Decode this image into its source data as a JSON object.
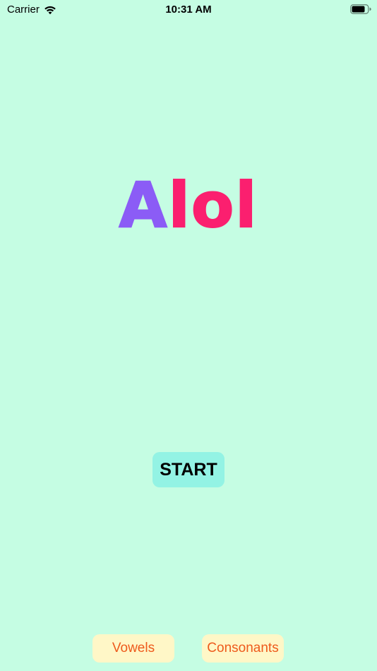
{
  "status_bar": {
    "carrier": "Carrier",
    "time": "10:31 AM",
    "wifi_icon": "wifi-icon",
    "battery_icon": "battery-icon"
  },
  "logo": {
    "first_letter": "A",
    "rest": "lol",
    "first_letter_color": "#8b5cf6",
    "rest_color": "#fb1f6f"
  },
  "start_button": {
    "label": "START"
  },
  "bottom_buttons": {
    "vowels_label": "Vowels",
    "consonants_label": "Consonants"
  },
  "colors": {
    "background": "#c5fde3",
    "start_button_bg": "#93f3e4",
    "pill_bg": "#fff7c7",
    "pill_text": "#ee5a1c"
  }
}
